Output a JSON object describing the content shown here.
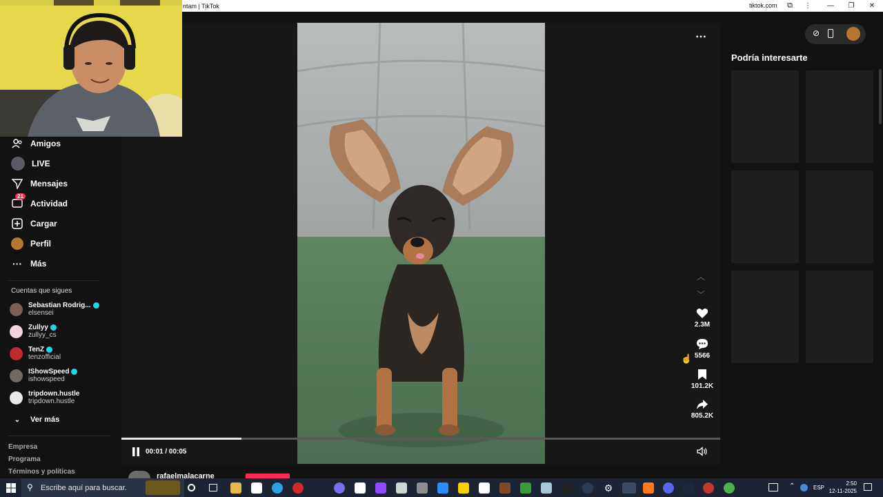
{
  "window": {
    "title": "ntam | TikTok",
    "domain": "tiktok.com",
    "controls": [
      "—",
      "❐",
      "✕"
    ]
  },
  "sidebar": {
    "nav": [
      {
        "label": "Amigos",
        "icon": "friends-icon"
      },
      {
        "label": "LIVE",
        "icon": "live-icon"
      },
      {
        "label": "Mensajes",
        "icon": "messages-icon"
      },
      {
        "label": "Actividad",
        "icon": "activity-icon",
        "badge": "21"
      },
      {
        "label": "Cargar",
        "icon": "upload-icon"
      },
      {
        "label": "Perfil",
        "icon": "profile-icon"
      },
      {
        "label": "Más",
        "icon": "more-icon"
      }
    ],
    "following_title": "Cuentas que sigues",
    "following": [
      {
        "name": "Sebastian Rodrig...",
        "handle": "elsensei",
        "verified": true
      },
      {
        "name": "Zullyy",
        "handle": "zullyy_cs",
        "verified": true
      },
      {
        "name": "TenZ",
        "handle": "tenzofficial",
        "verified": true
      },
      {
        "name": "IShowSpeed",
        "handle": "ishowspeed",
        "verified": true
      },
      {
        "name": "tripdown.hustle",
        "handle": "tripdown.hustle",
        "verified": false
      }
    ],
    "see_more": "Ver más",
    "footer": [
      "Empresa",
      "Programa",
      "Términos y políticas"
    ]
  },
  "player": {
    "time": "00:01 / 00:05",
    "progress": 0.2,
    "author_partial": "rafaelmalacarne",
    "actions": {
      "likes": "2.3M",
      "comments": "5566",
      "saves": "101.2K",
      "shares": "805.2K"
    }
  },
  "right": {
    "title": "Podría interesarte"
  },
  "taskbar": {
    "search_placeholder": "Escribe aquí para buscar.",
    "lang": "ESP",
    "time": "2:50",
    "date": "12-11-2025"
  }
}
